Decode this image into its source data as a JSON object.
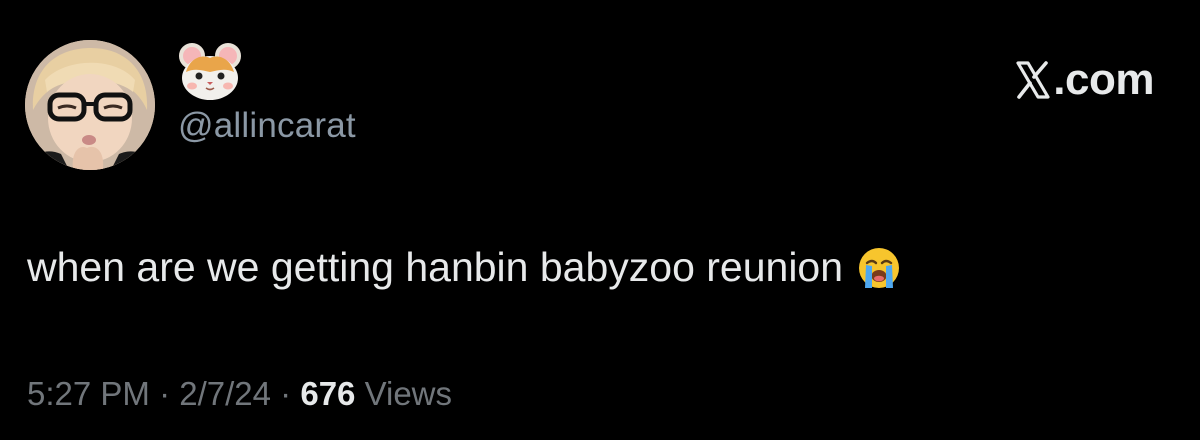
{
  "author": {
    "display_name_icon": "hamster-face-icon",
    "handle": "@allincarat",
    "avatar_icon": "profile-photo-avatar"
  },
  "brand": {
    "icon": "x-logo-icon",
    "suffix": ".com"
  },
  "tweet": {
    "text": "when are we getting hanbin babyzoo reunion",
    "trailing_emoji_icon": "loudly-crying-face-icon"
  },
  "meta": {
    "time": "5:27 PM",
    "separator": "·",
    "date": "2/7/24",
    "views_count": "676",
    "views_label": "Views"
  },
  "colors": {
    "background": "#000000",
    "primary_text": "#e7e9ea",
    "secondary_text": "#71767b",
    "handle_text": "#8b98a5"
  }
}
